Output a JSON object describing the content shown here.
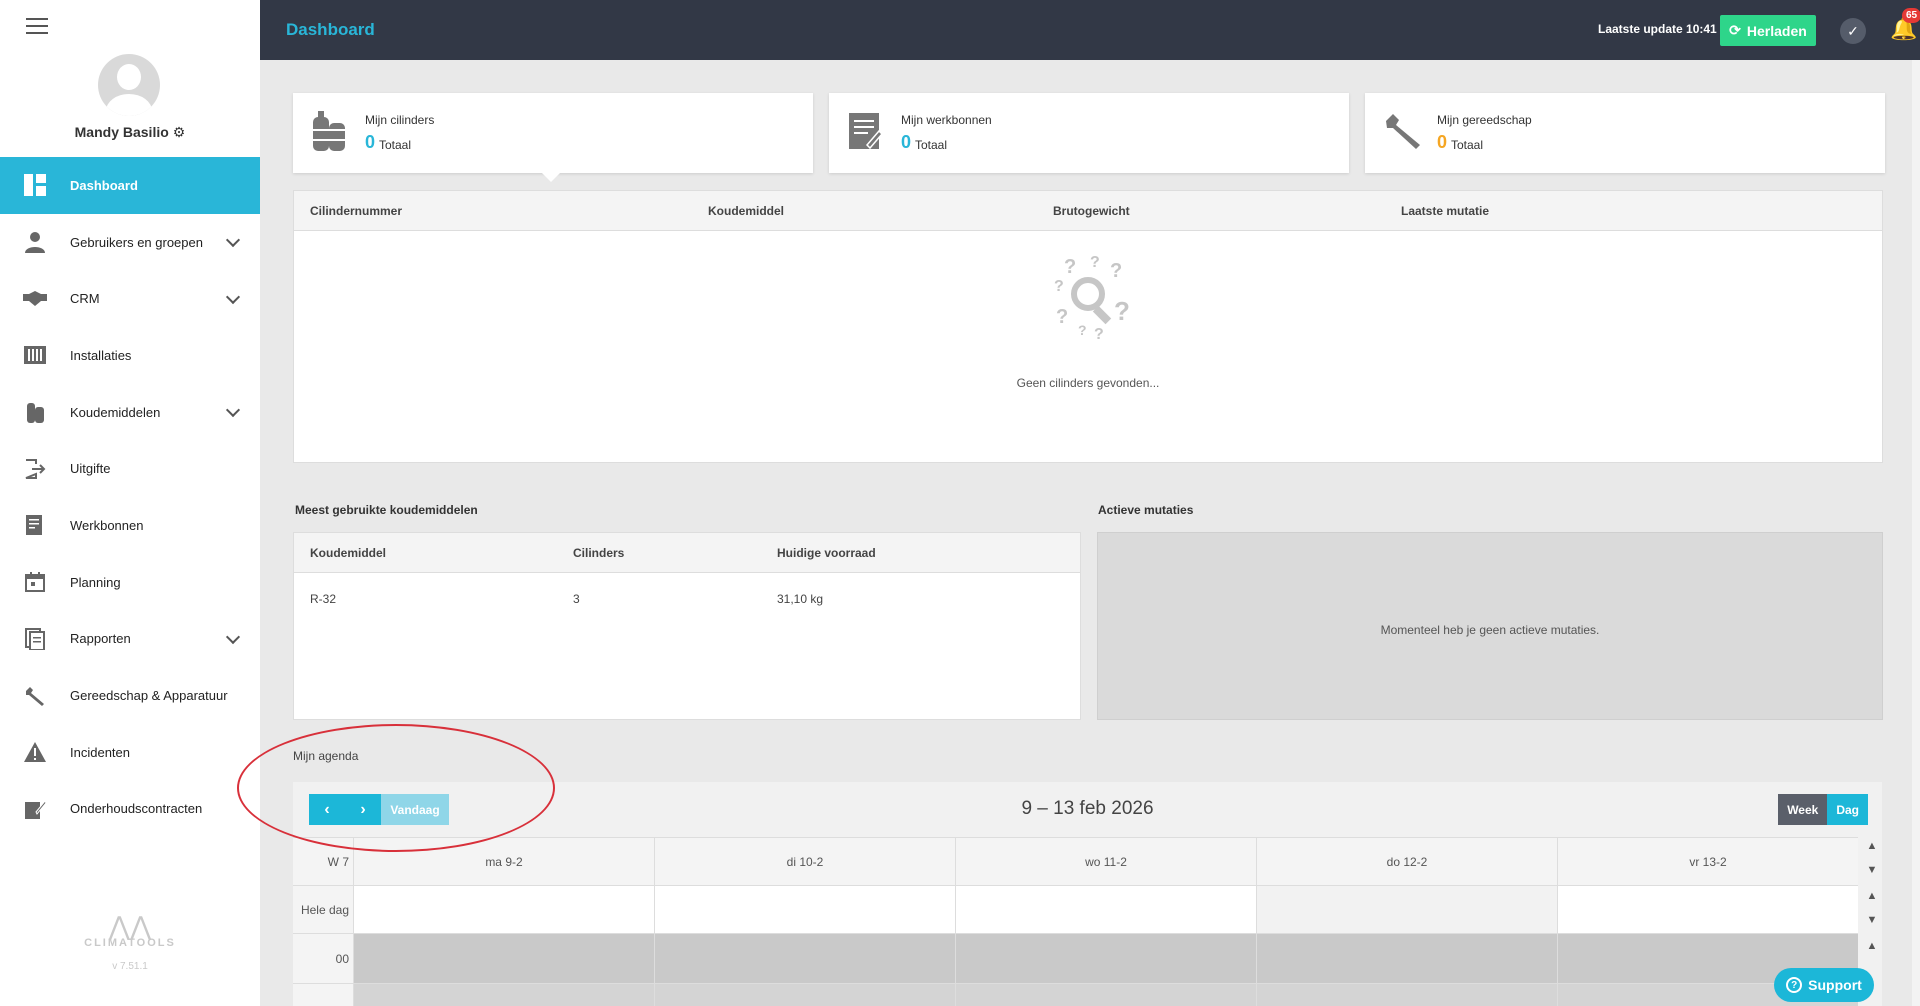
{
  "app": {
    "title": "Dashboard",
    "last_update": "Laatste update 10:41",
    "reload_label": "Herladen",
    "notification_count": "65",
    "accent_color": "#29b6d8"
  },
  "user": {
    "name": "Mandy Basilio"
  },
  "sidebar": {
    "items": [
      {
        "label": "Dashboard",
        "icon": "dashboard-icon",
        "active": true
      },
      {
        "label": "Gebruikers en groepen",
        "icon": "user-icon",
        "expandable": true
      },
      {
        "label": "CRM",
        "icon": "handshake-icon",
        "expandable": true
      },
      {
        "label": "Installaties",
        "icon": "installation-icon"
      },
      {
        "label": "Koudemiddelen",
        "icon": "cylinders-icon",
        "expandable": true
      },
      {
        "label": "Uitgifte",
        "icon": "sign-out-icon"
      },
      {
        "label": "Werkbonnen",
        "icon": "workorder-icon"
      },
      {
        "label": "Planning",
        "icon": "calendar-icon"
      },
      {
        "label": "Rapporten",
        "icon": "report-icon",
        "expandable": true
      },
      {
        "label": "Gereedschap & Apparatuur",
        "icon": "wrench-icon"
      },
      {
        "label": "Incidenten",
        "icon": "warning-icon"
      },
      {
        "label": "Onderhoudscontracten",
        "icon": "contract-icon"
      }
    ],
    "logo_text": "CLIMATOOLS",
    "version": "v 7.51.1"
  },
  "cards": [
    {
      "title": "Mijn cilinders",
      "value": "0",
      "suffix": "Totaal",
      "color": "#29b6d8",
      "icon": "cylinders-icon"
    },
    {
      "title": "Mijn werkbonnen",
      "value": "0",
      "suffix": "Totaal",
      "color": "#29b6d8",
      "icon": "workorder-icon"
    },
    {
      "title": "Mijn gereedschap",
      "value": "0",
      "suffix": "Totaal",
      "color": "#f5a623",
      "icon": "wrench-icon"
    }
  ],
  "cylinders_table": {
    "columns": [
      "Cilindernummer",
      "Koudemiddel",
      "Brutogewicht",
      "Laatste mutatie"
    ],
    "empty_text": "Geen cilinders gevonden..."
  },
  "refrigerants": {
    "title": "Meest gebruikte koudemiddelen",
    "columns": [
      "Koudemiddel",
      "Cilinders",
      "Huidige voorraad"
    ],
    "rows": [
      [
        "R-32",
        "3",
        "31,10 kg"
      ]
    ]
  },
  "mutations": {
    "title": "Actieve mutaties",
    "empty_text": "Momenteel heb je geen actieve mutaties."
  },
  "agenda": {
    "title": "Mijn agenda",
    "today_label": "Vandaag",
    "range": "9 – 13 feb 2026",
    "week_label": "Week",
    "day_label": "Dag",
    "week_number": "W 7",
    "all_day_label": "Hele dag",
    "hour_label": "00",
    "days": [
      "ma 9-2",
      "di 10-2",
      "wo 11-2",
      "do 12-2",
      "vr 13-2"
    ]
  },
  "support_label": "Support"
}
